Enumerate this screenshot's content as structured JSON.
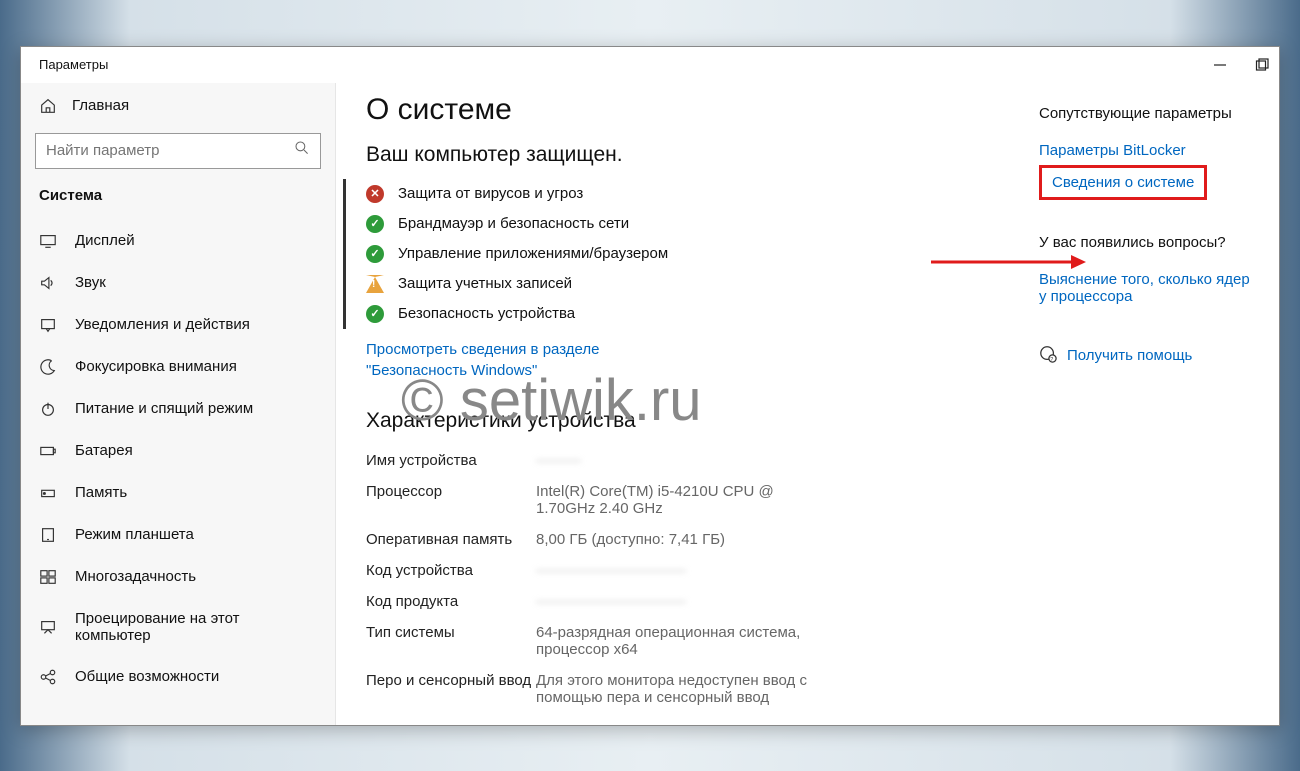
{
  "window": {
    "title": "Параметры"
  },
  "sidebar": {
    "home": "Главная",
    "search_placeholder": "Найти параметр",
    "section": "Система",
    "items": [
      {
        "label": "Дисплей"
      },
      {
        "label": "Звук"
      },
      {
        "label": "Уведомления и действия"
      },
      {
        "label": "Фокусировка внимания"
      },
      {
        "label": "Питание и спящий режим"
      },
      {
        "label": "Батарея"
      },
      {
        "label": "Память"
      },
      {
        "label": "Режим планшета"
      },
      {
        "label": "Многозадачность"
      },
      {
        "label": "Проецирование на этот компьютер"
      },
      {
        "label": "Общие возможности"
      }
    ]
  },
  "main": {
    "title": "О системе",
    "security_heading": "Ваш компьютер защищен.",
    "security_items": [
      {
        "status": "bad",
        "label": "Защита от вирусов и угроз"
      },
      {
        "status": "ok",
        "label": "Брандмауэр и безопасность сети"
      },
      {
        "status": "ok",
        "label": "Управление приложениями/браузером"
      },
      {
        "status": "warn",
        "label": "Защита учетных записей"
      },
      {
        "status": "ok",
        "label": "Безопасность устройства"
      }
    ],
    "security_link": "Просмотреть сведения в разделе \"Безопасность Windows\"",
    "device_heading": "Характеристики устройства",
    "specs": [
      {
        "label": "Имя устройства",
        "value": "———",
        "blur": true
      },
      {
        "label": "Процессор",
        "value": "Intel(R) Core(TM) i5-4210U CPU @ 1.70GHz 2.40 GHz"
      },
      {
        "label": "Оперативная память",
        "value": "8,00 ГБ (доступно: 7,41 ГБ)"
      },
      {
        "label": "Код устройства",
        "value": "——————————",
        "blur": true
      },
      {
        "label": "Код продукта",
        "value": "——————————",
        "blur": true
      },
      {
        "label": "Тип системы",
        "value": "64-разрядная операционная система, процессор x64"
      },
      {
        "label": "Перо и сенсорный ввод",
        "value": "Для этого монитора недоступен ввод с помощью пера и сенсорный ввод"
      }
    ]
  },
  "right": {
    "related_heading": "Сопутствующие параметры",
    "links": [
      {
        "label": "Параметры BitLocker",
        "hl": false
      },
      {
        "label": "Сведения о системе",
        "hl": true
      }
    ],
    "question_heading": "У вас появились вопросы?",
    "question_link": "Выяснение того, сколько ядер у процессора",
    "help_link": "Получить помощь"
  },
  "watermark": "© setiwik.ru"
}
